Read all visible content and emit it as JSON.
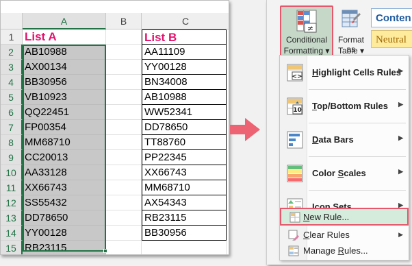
{
  "sheet": {
    "columns": [
      "A",
      "B",
      "C"
    ],
    "rows": [
      "1",
      "2",
      "3",
      "4",
      "5",
      "6",
      "7",
      "8",
      "9",
      "10",
      "11",
      "12",
      "13",
      "14",
      "15"
    ],
    "listA": {
      "header": "List A",
      "values": [
        "AB10988",
        "AX00134",
        "BB30956",
        "VB10923",
        "QQ22451",
        "FP00354",
        "MM68710",
        "CC20013",
        "AA33128",
        "XX66743",
        "SS55432",
        "DD78650",
        "YY00128",
        "RB23115"
      ]
    },
    "listB": {
      "header": "List B",
      "values": [
        "AA11109",
        "YY00128",
        "BN34008",
        "AB10988",
        "WW52341",
        "DD78650",
        "TT88760",
        "PP22345",
        "XX66743",
        "MM68710",
        "AX54343",
        "RB23115",
        "BB30956"
      ]
    }
  },
  "ribbon": {
    "conditional_formatting": {
      "line1": "Conditional",
      "line2": "Formatting ▾",
      "icon": "conditional-formatting-icon"
    },
    "format_as_table": {
      "line1": "Format as",
      "line2": "Table ▾",
      "icon": "format-as-table-icon"
    },
    "styles": {
      "content": "Conten",
      "neutral": "Neutral"
    }
  },
  "menu": {
    "big_items": [
      {
        "label_u": "H",
        "label_rest": "ighlight Cells Rules",
        "icon": "highlight-cells-rules-icon"
      },
      {
        "label_u": "T",
        "label_rest": "op/Bottom Rules",
        "icon": "top-bottom-rules-icon"
      },
      {
        "label_u": "D",
        "label_rest": "ata Bars",
        "icon": "data-bars-icon"
      },
      {
        "label_pre": "Color ",
        "label_u": "S",
        "label_rest": "cales",
        "icon": "color-scales-icon"
      },
      {
        "label_u": "I",
        "label_rest": "con Sets",
        "icon": "icon-sets-icon"
      }
    ],
    "new_rule": {
      "label_u": "N",
      "label_rest": "ew Rule...",
      "icon": "new-rule-icon"
    },
    "clear_rules": {
      "label_u": "C",
      "label_rest": "lear Rules",
      "icon": "clear-rules-icon"
    },
    "manage_rules": {
      "label_pre": "Manage ",
      "label_u": "R",
      "label_rest": "ules...",
      "icon": "manage-rules-icon"
    }
  },
  "colors": {
    "header_text": "#e3116c",
    "highlight_border": "#e6576b",
    "selection_green": "#217346",
    "arrow": "#ed6373"
  }
}
